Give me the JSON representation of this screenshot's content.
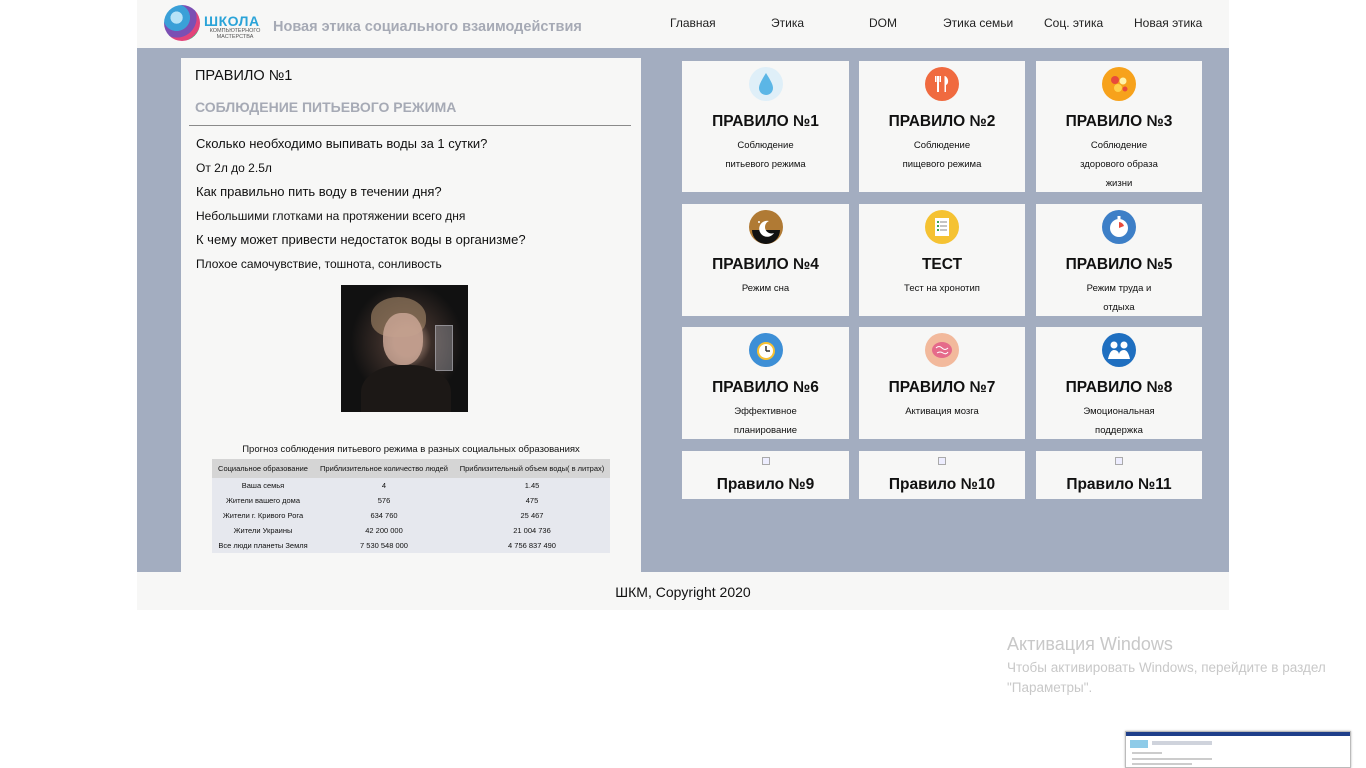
{
  "header": {
    "logo_title": "ШКОЛА",
    "logo_sub": "КОМПЬЮТЕРНОГО МАСТЕРСТВА",
    "site_title": "Новая этика социального взаимодействия",
    "nav": [
      "Главная",
      "Этика",
      "DOM",
      "Этика семьи",
      "Соц. этика",
      "Новая этика"
    ]
  },
  "article": {
    "rule_no": "ПРАВИЛО №1",
    "rule_name": "СОБЛЮДЕНИЕ ПИТЬЕВОГО РЕЖИМА",
    "qa": [
      {
        "q": "Сколько необходимо выпивать воды за 1 сутки?",
        "a": "От 2л до 2.5л"
      },
      {
        "q": "Как правильно пить воду в течении дня?",
        "a": "Небольшими глотками на протяжении всего дня"
      },
      {
        "q": "К чему может привести недостаток воды в организме?",
        "a": "Плохое самочувствие, тошнота, сонливость"
      }
    ],
    "table": {
      "caption": "Прогноз соблюдения питьевого режима в разных социальных образованиях",
      "headers": [
        "Социальное образование",
        "Приблизительное количество людей",
        "Приблизительный объем воды( в литрах)"
      ],
      "rows": [
        [
          "Ваша семья",
          "4",
          "1.45"
        ],
        [
          "Жители вашего дома",
          "576",
          "475"
        ],
        [
          "Жители г. Кривого Рога",
          "634 760",
          "25 467"
        ],
        [
          "Жители Украины",
          "42 200 000",
          "21 004 736"
        ],
        [
          "Все люди планеты Земля",
          "7 530 548 000",
          "4 756 837 490"
        ]
      ]
    }
  },
  "cards": [
    {
      "title": "ПРАВИЛО №1",
      "desc": [
        "Соблюдение",
        "питьевого режима"
      ],
      "icon": "water-drop-icon",
      "color": "#5bb6e6"
    },
    {
      "title": "ПРАВИЛО №2",
      "desc": [
        "Соблюдение",
        "пищевого режима"
      ],
      "icon": "fork-knife-icon",
      "color": "#f06a3f"
    },
    {
      "title": "ПРАВИЛО №3",
      "desc": [
        "Соблюдение",
        "здорового образа",
        "жизни"
      ],
      "icon": "healthy-food-icon",
      "color": "#f7a21b"
    },
    {
      "title": "ПРАВИЛО №4",
      "desc": [
        "Режим сна"
      ],
      "icon": "moon-stars-icon",
      "color": "#2a1f18"
    },
    {
      "title": "ТЕСТ",
      "desc": [
        "Тест на хронотип"
      ],
      "icon": "checklist-icon",
      "color": "#f5c232"
    },
    {
      "title": "ПРАВИЛО №5",
      "desc": [
        "Режим труда и",
        "отдыха"
      ],
      "icon": "stopwatch-icon",
      "color": "#3d7fc7"
    },
    {
      "title": "ПРАВИЛО №6",
      "desc": [
        "Эффективное",
        "планирование"
      ],
      "icon": "alarm-clock-icon",
      "color": "#3d8fd6"
    },
    {
      "title": "ПРАВИЛО №7",
      "desc": [
        "Активация мозга"
      ],
      "icon": "brain-icon",
      "color": "#f2b99c"
    },
    {
      "title": "ПРАВИЛО №8",
      "desc": [
        "Эмоциональная",
        "поддержка"
      ],
      "icon": "support-people-icon",
      "color": "#1f6fc0"
    },
    {
      "title": "Правило №9",
      "desc": [],
      "icon": "broken-image-icon",
      "color": "#cccccc"
    },
    {
      "title": "Правило №10",
      "desc": [],
      "icon": "broken-image-icon",
      "color": "#cccccc"
    },
    {
      "title": "Правило №11",
      "desc": [],
      "icon": "broken-image-icon",
      "color": "#cccccc"
    }
  ],
  "footer": {
    "copyright": "ШКМ, Copyright 2020"
  },
  "watermark": {
    "title": "Активация Windows",
    "text": "Чтобы активировать Windows, перейдите в раздел \"Параметры\"."
  }
}
